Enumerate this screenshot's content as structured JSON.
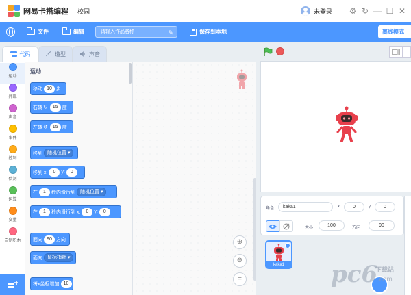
{
  "app": {
    "title": "网易卡搭编程",
    "campus": "校园",
    "login_label": "未登录"
  },
  "menubar": {
    "file": "文件",
    "edit": "编辑",
    "project_name_placeholder": "请输入作品名称",
    "save_local": "保存到本地",
    "offline_mode": "离线模式"
  },
  "tabs": {
    "code": "代码",
    "costume": "造型",
    "sound": "声音"
  },
  "categories": [
    {
      "label": "运动",
      "color": "#4c97ff"
    },
    {
      "label": "外观",
      "color": "#9966ff"
    },
    {
      "label": "声音",
      "color": "#cf63cf"
    },
    {
      "label": "事件",
      "color": "#ffbf00"
    },
    {
      "label": "控制",
      "color": "#ffab19"
    },
    {
      "label": "侦测",
      "color": "#5cb1d6"
    },
    {
      "label": "运算",
      "color": "#59c059"
    },
    {
      "label": "变量",
      "color": "#ff8c1a"
    },
    {
      "label": "自制积木",
      "color": "#ff6680"
    }
  ],
  "palette": {
    "section_title": "运动",
    "blocks": {
      "move_w1": "移动",
      "move_val": "10",
      "move_w2": "步",
      "turn_right_w1": "右转",
      "turn_right_val": "15",
      "turn_right_w2": "度",
      "turn_left_w1": "左转",
      "turn_left_val": "15",
      "turn_left_w2": "度",
      "goto_w1": "移到",
      "goto_dd": "随机位置",
      "gotoxy_w1": "移到 x:",
      "gotoxy_x": "0",
      "gotoxy_w2": "y:",
      "gotoxy_y": "0",
      "glide_w1": "在",
      "glide_secs": "1",
      "glide_w2": "秒内滑行到",
      "glide_dd": "随机位置",
      "glidexy_w1": "在",
      "glidexy_secs": "1",
      "glidexy_w2": "秒内滑行到 x:",
      "glidexy_x": "0",
      "glidexy_w3": "y:",
      "glidexy_y": "0",
      "point_w1": "面向",
      "point_val": "90",
      "point_w2": "方向",
      "pointto_w1": "面向",
      "pointto_dd": "鼠标指针",
      "changex_w1": "将x坐标增加",
      "changex_val": "10"
    }
  },
  "sprite_info": {
    "role_label": "角色",
    "name": "kaka1",
    "x_label": "x",
    "x": "0",
    "y_label": "y",
    "y": "0",
    "size_label": "大小",
    "size": "100",
    "direction_label": "方向",
    "direction": "90"
  },
  "sprite_list": [
    {
      "label": "kaka1"
    }
  ],
  "zoom": {
    "reset_label": "="
  },
  "watermark": {
    "text": "pc6",
    "small": "下载站",
    "sub": ".com"
  },
  "colors": {
    "accent": "#4c97ff",
    "robot_red": "#e8404c"
  }
}
